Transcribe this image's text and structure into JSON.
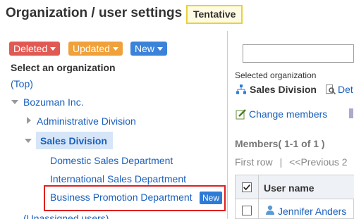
{
  "header": {
    "title": "Organization / user settings",
    "badge": "Tentative"
  },
  "filters": {
    "deleted": "Deleted",
    "updated": "Updated",
    "new": "New"
  },
  "left": {
    "heading": "Select an organization",
    "top_link": "(Top)",
    "root": "Bozuman Inc.",
    "admin_division": "Administrative Division",
    "sales_division": "Sales Division",
    "children": [
      "Domestic Sales Department",
      "International Sales Department",
      "Business Promotion Department"
    ],
    "new_badge": "New",
    "unassigned": "(Unassigned users)"
  },
  "right": {
    "selected_label": "Selected organization",
    "selected_org": "Sales Division",
    "details_partial": "Det",
    "change_members": "Change members",
    "members_heading": "Members( 1-1 of 1 )",
    "first_row": "First row",
    "separator": "|",
    "previous": "<<Previous 2",
    "user_name_header": "User name",
    "user_name": "Jennifer Anders"
  },
  "colors": {
    "accent": "#1a5fbd",
    "deleted": "#e05a53",
    "updated": "#f0a13a",
    "new": "#3b82d9",
    "highlight": "#e01f1f"
  }
}
